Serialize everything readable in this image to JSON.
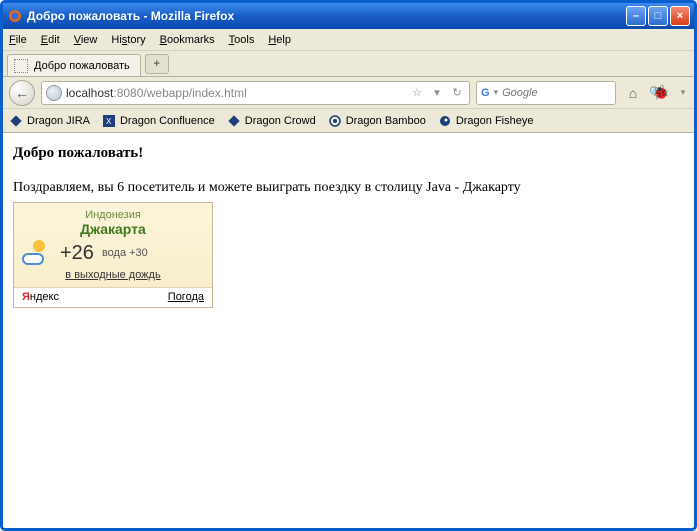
{
  "window": {
    "title": "Добро пожаловать - Mozilla Firefox"
  },
  "menu": {
    "file": "File",
    "edit": "Edit",
    "view": "View",
    "history": "History",
    "bookmarks": "Bookmarks",
    "tools": "Tools",
    "help": "Help"
  },
  "tab": {
    "title": "Добро пожаловать"
  },
  "url": {
    "host": "localhost",
    "rest": ":8080/webapp/index.html"
  },
  "search": {
    "placeholder": "Google"
  },
  "bookmarks": {
    "jira": "Dragon JIRA",
    "confluence": "Dragon Confluence",
    "crowd": "Dragon Crowd",
    "bamboo": "Dragon Bamboo",
    "fisheye": "Dragon Fisheye"
  },
  "page": {
    "heading": "Добро пожаловать!",
    "congrats": "Поздравляем, вы 6 посетитель и можете выиграть поездку в столицу Java - Джакарту"
  },
  "weather": {
    "country": "Индонезия",
    "city": "Джакарта",
    "temp": "+26",
    "water": "вода +30",
    "note": "в выходные дождь",
    "brand_y": "Я",
    "brand_rest": "ндекс",
    "service": "Погода"
  }
}
